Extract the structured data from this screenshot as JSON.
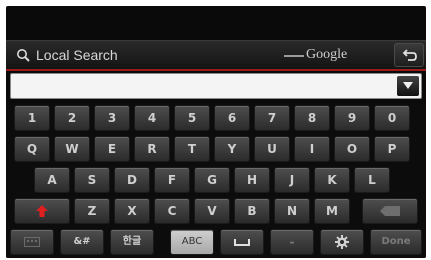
{
  "header": {
    "title": "Local Search",
    "provider": "Google",
    "icons": [
      "search-icon",
      "back-icon"
    ]
  },
  "input": {
    "value": "",
    "dropdown_icon": "triangle-down-icon"
  },
  "keyboard": {
    "row1": [
      "1",
      "2",
      "3",
      "4",
      "5",
      "6",
      "7",
      "8",
      "9",
      "0"
    ],
    "row2": [
      "Q",
      "W",
      "E",
      "R",
      "T",
      "Y",
      "U",
      "I",
      "O",
      "P"
    ],
    "row3": [
      "A",
      "S",
      "D",
      "F",
      "G",
      "H",
      "J",
      "K",
      "L"
    ],
    "row4": [
      "Z",
      "X",
      "C",
      "V",
      "B",
      "N",
      "M"
    ],
    "bottom": {
      "symbols": "&#",
      "korean": "한글",
      "abc": "ABC",
      "dash": "-",
      "done": "Done"
    }
  },
  "colors": {
    "accent_red": "#9b1a1a",
    "shift_red": "#e02020"
  }
}
